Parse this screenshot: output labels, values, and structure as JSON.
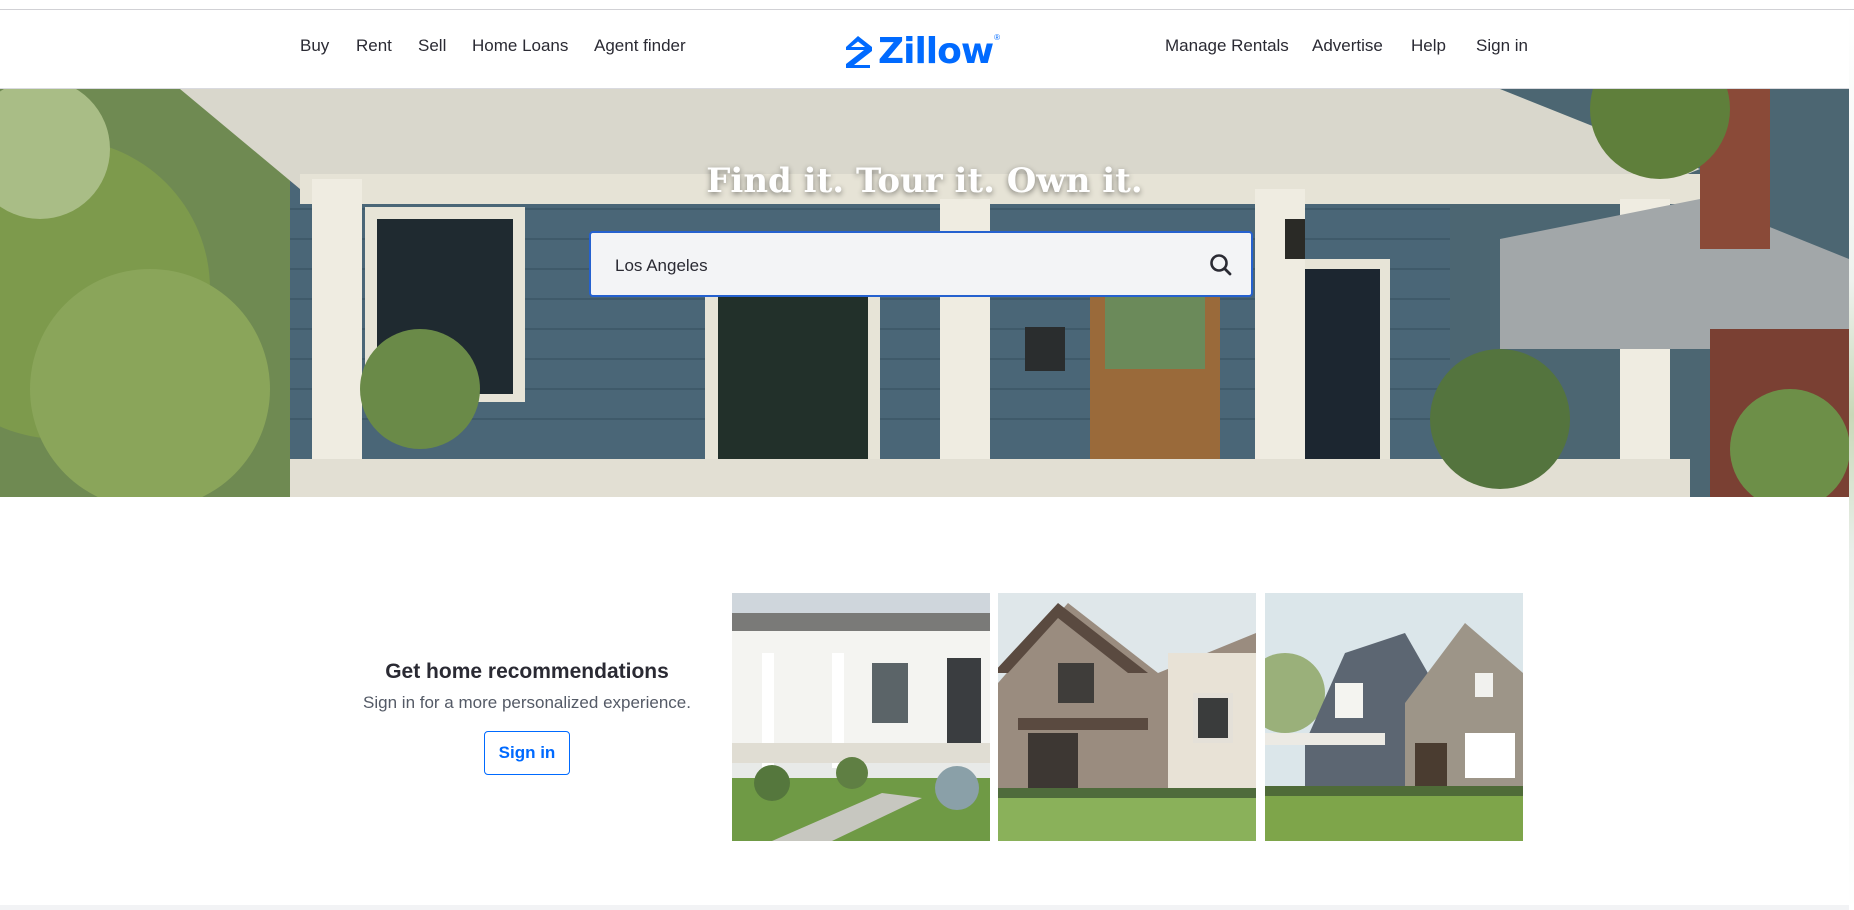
{
  "header": {
    "nav_left": [
      "Buy",
      "Rent",
      "Sell",
      "Home Loans",
      "Agent finder"
    ],
    "logo_text": "Zillow",
    "logo_mark": "®",
    "nav_right": [
      "Manage Rentals",
      "Advertise",
      "Help",
      "Sign in"
    ]
  },
  "hero": {
    "title": "Find it. Tour it. Own it.",
    "search_value": "Los Angeles",
    "search_icon": "search-icon"
  },
  "recommendations": {
    "title": "Get home recommendations",
    "subtitle": "Sign in for a more personalized experience.",
    "button_label": "Sign in"
  },
  "colors": {
    "brand_blue": "#006aff",
    "search_border": "#2561cf",
    "text": "#2a2a33"
  }
}
